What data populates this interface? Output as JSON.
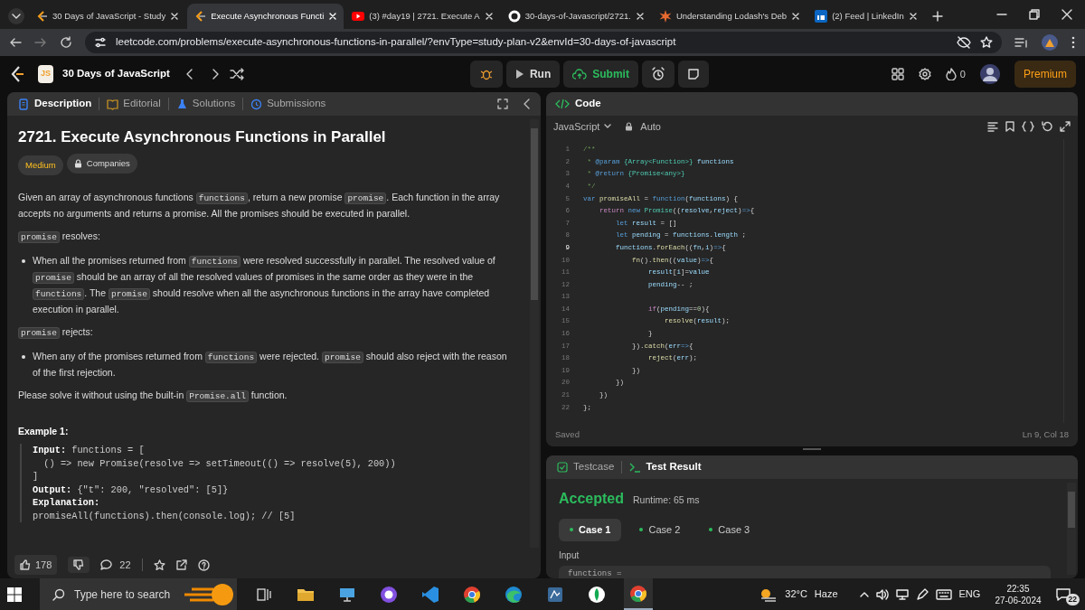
{
  "browser": {
    "tabs": [
      {
        "title": "30 Days of JavaScript - Study",
        "selected": false
      },
      {
        "title": "Execute Asynchronous Functi",
        "selected": true
      },
      {
        "title": "(3) #day19 | 2721. Execute A",
        "selected": false
      },
      {
        "title": "30-days-of-Javascript/2721.",
        "selected": false
      },
      {
        "title": "Understanding Lodash's Deb",
        "selected": false
      },
      {
        "title": "(2) Feed | LinkedIn",
        "selected": false
      }
    ],
    "url": "leetcode.com/problems/execute-asynchronous-functions-in-parallel/?envType=study-plan-v2&envId=30-days-of-javascript"
  },
  "topbar": {
    "badge": "JS",
    "study_plan": "30 Days of JavaScript",
    "run": "Run",
    "submit": "Submit",
    "streak": "0",
    "premium": "Premium"
  },
  "description_panel": {
    "tabs": [
      {
        "label": "Description",
        "selected": true
      },
      {
        "label": "Editorial",
        "selected": false
      },
      {
        "label": "Solutions",
        "selected": false
      },
      {
        "label": "Submissions",
        "selected": false
      }
    ],
    "title": "2721. Execute Asynchronous Functions in Parallel",
    "difficulty": "Medium",
    "companies": "Companies",
    "body": [
      {
        "kind": "para",
        "segments": [
          {
            "kind": "text",
            "text": "Given an array of asynchronous functions "
          },
          {
            "kind": "code",
            "text": "functions"
          },
          {
            "kind": "text",
            "text": ", return a new promise "
          },
          {
            "kind": "code",
            "text": "promise"
          },
          {
            "kind": "text",
            "text": ". Each function in the array accepts no arguments and returns a promise. All the promises should be executed in parallel."
          }
        ]
      },
      {
        "kind": "para",
        "segments": [
          {
            "kind": "code",
            "text": "promise"
          },
          {
            "kind": "text",
            "text": " resolves:"
          }
        ]
      },
      {
        "kind": "bullet",
        "segments": [
          {
            "kind": "text",
            "text": "When all the promises returned from "
          },
          {
            "kind": "code",
            "text": "functions"
          },
          {
            "kind": "text",
            "text": " were resolved successfully in parallel. The resolved value of "
          },
          {
            "kind": "code",
            "text": "promise"
          },
          {
            "kind": "text",
            "text": " should be an array of all the resolved values of promises in the same order as they were in the "
          },
          {
            "kind": "code",
            "text": "functions"
          },
          {
            "kind": "text",
            "text": ". The "
          },
          {
            "kind": "code",
            "text": "promise"
          },
          {
            "kind": "text",
            "text": " should resolve when all the asynchronous functions in the array have completed execution in parallel."
          }
        ]
      },
      {
        "kind": "para",
        "segments": [
          {
            "kind": "code",
            "text": "promise"
          },
          {
            "kind": "text",
            "text": " rejects:"
          }
        ]
      },
      {
        "kind": "bullet",
        "segments": [
          {
            "kind": "text",
            "text": "When any of the promises returned from "
          },
          {
            "kind": "code",
            "text": "functions"
          },
          {
            "kind": "text",
            "text": " were rejected. "
          },
          {
            "kind": "code",
            "text": "promise"
          },
          {
            "kind": "text",
            "text": " should also reject with the reason of the first rejection."
          }
        ]
      },
      {
        "kind": "para",
        "segments": [
          {
            "kind": "text",
            "text": "Please solve it without using the built-in "
          },
          {
            "kind": "code",
            "text": "Promise.all"
          },
          {
            "kind": "text",
            "text": " function."
          }
        ]
      }
    ],
    "example": {
      "heading": "Example 1:",
      "lines": [
        "**Input:** functions = [",
        "  () => new Promise(resolve => setTimeout(() => resolve(5), 200))",
        "]",
        "**Output:** {\"t\": 200, \"resolved\": [5]}",
        "**Explanation:**",
        "promiseAll(functions).then(console.log); // [5]"
      ]
    },
    "footer": {
      "likes": "178",
      "comments": "22"
    }
  },
  "code_panel": {
    "title": "Code",
    "language": "JavaScript",
    "mode": "Auto",
    "lines": [
      {
        "number": "1",
        "current": false,
        "tokens": [
          {
            "kind": "comment",
            "text": "/**"
          }
        ]
      },
      {
        "number": "2",
        "current": false,
        "tokens": [
          {
            "kind": "comment",
            "text": " * "
          },
          {
            "kind": "doctag",
            "text": "@param"
          },
          {
            "kind": "type",
            "text": " {Array<Function>}"
          },
          {
            "kind": "name",
            "text": " functions"
          }
        ]
      },
      {
        "number": "3",
        "current": false,
        "tokens": [
          {
            "kind": "comment",
            "text": " * "
          },
          {
            "kind": "doctag",
            "text": "@return"
          },
          {
            "kind": "type",
            "text": " {Promise<any>}"
          }
        ]
      },
      {
        "number": "4",
        "current": false,
        "tokens": [
          {
            "kind": "comment",
            "text": " */"
          }
        ]
      },
      {
        "number": "5",
        "current": false,
        "tokens": [
          {
            "kind": "keyword",
            "text": "var"
          },
          {
            "kind": "function",
            "text": " promiseAll"
          },
          {
            "kind": "punct",
            "text": " = "
          },
          {
            "kind": "keyword",
            "text": "function"
          },
          {
            "kind": "punct",
            "text": "("
          },
          {
            "kind": "name",
            "text": "functions"
          },
          {
            "kind": "punct",
            "text": ") {"
          }
        ]
      },
      {
        "number": "6",
        "current": false,
        "tokens": [
          {
            "kind": "control",
            "text": "    return"
          },
          {
            "kind": "keyword",
            "text": " new"
          },
          {
            "kind": "class",
            "text": " Promise"
          },
          {
            "kind": "punct",
            "text": "(("
          },
          {
            "kind": "name",
            "text": "resolve"
          },
          {
            "kind": "punct",
            "text": ","
          },
          {
            "kind": "name",
            "text": "reject"
          },
          {
            "kind": "punct",
            "text": ")"
          },
          {
            "kind": "keyword",
            "text": "=>"
          },
          {
            "kind": "punct",
            "text": "{"
          }
        ]
      },
      {
        "number": "7",
        "current": false,
        "tokens": [
          {
            "kind": "keyword",
            "text": "        let"
          },
          {
            "kind": "name",
            "text": " result"
          },
          {
            "kind": "punct",
            "text": " = []"
          }
        ]
      },
      {
        "number": "8",
        "current": false,
        "tokens": [
          {
            "kind": "keyword",
            "text": "        let"
          },
          {
            "kind": "name",
            "text": " pending"
          },
          {
            "kind": "punct",
            "text": " = "
          },
          {
            "kind": "name",
            "text": "functions"
          },
          {
            "kind": "punct",
            "text": "."
          },
          {
            "kind": "name",
            "text": "length"
          },
          {
            "kind": "punct",
            "text": " ;"
          }
        ]
      },
      {
        "number": "9",
        "current": true,
        "tokens": [
          {
            "kind": "name",
            "text": "        functions"
          },
          {
            "kind": "punct",
            "text": "."
          },
          {
            "kind": "function",
            "text": "forEach"
          },
          {
            "kind": "punct",
            "text": "(("
          },
          {
            "kind": "name",
            "text": "fn"
          },
          {
            "kind": "punct",
            "text": ","
          },
          {
            "kind": "name",
            "text": "i"
          },
          {
            "kind": "punct",
            "text": ")"
          },
          {
            "kind": "keyword",
            "text": "=>"
          },
          {
            "kind": "punct",
            "text": "{"
          }
        ]
      },
      {
        "number": "10",
        "current": false,
        "tokens": [
          {
            "kind": "function",
            "text": "            fn"
          },
          {
            "kind": "punct",
            "text": "()."
          },
          {
            "kind": "function",
            "text": "then"
          },
          {
            "kind": "punct",
            "text": "(("
          },
          {
            "kind": "name",
            "text": "value"
          },
          {
            "kind": "punct",
            "text": ")"
          },
          {
            "kind": "keyword",
            "text": "=>"
          },
          {
            "kind": "punct",
            "text": "{"
          }
        ]
      },
      {
        "number": "11",
        "current": false,
        "tokens": [
          {
            "kind": "name",
            "text": "                result"
          },
          {
            "kind": "punct",
            "text": "["
          },
          {
            "kind": "name",
            "text": "i"
          },
          {
            "kind": "punct",
            "text": "]="
          },
          {
            "kind": "name",
            "text": "value"
          }
        ]
      },
      {
        "number": "12",
        "current": false,
        "tokens": [
          {
            "kind": "name",
            "text": "                pending"
          },
          {
            "kind": "punct",
            "text": "-- ;"
          }
        ]
      },
      {
        "number": "13",
        "current": false
      },
      {
        "number": "14",
        "current": false,
        "tokens": [
          {
            "kind": "control",
            "text": "                if"
          },
          {
            "kind": "punct",
            "text": "("
          },
          {
            "kind": "name",
            "text": "pending"
          },
          {
            "kind": "punct",
            "text": "=="
          },
          {
            "kind": "number",
            "text": "0"
          },
          {
            "kind": "punct",
            "text": "){"
          }
        ]
      },
      {
        "number": "15",
        "current": false,
        "tokens": [
          {
            "kind": "function",
            "text": "                    resolve"
          },
          {
            "kind": "punct",
            "text": "("
          },
          {
            "kind": "name",
            "text": "result"
          },
          {
            "kind": "punct",
            "text": ");"
          }
        ]
      },
      {
        "number": "16",
        "current": false,
        "tokens": [
          {
            "kind": "punct",
            "text": "                }"
          }
        ]
      },
      {
        "number": "17",
        "current": false,
        "tokens": [
          {
            "kind": "punct",
            "text": "            })."
          },
          {
            "kind": "function",
            "text": "catch"
          },
          {
            "kind": "punct",
            "text": "("
          },
          {
            "kind": "name",
            "text": "err"
          },
          {
            "kind": "keyword",
            "text": "=>"
          },
          {
            "kind": "punct",
            "text": "{"
          }
        ]
      },
      {
        "number": "18",
        "current": false,
        "tokens": [
          {
            "kind": "function",
            "text": "                reject"
          },
          {
            "kind": "punct",
            "text": "("
          },
          {
            "kind": "name",
            "text": "err"
          },
          {
            "kind": "punct",
            "text": ");"
          }
        ]
      },
      {
        "number": "19",
        "current": false,
        "tokens": [
          {
            "kind": "punct",
            "text": "            })"
          }
        ]
      },
      {
        "number": "20",
        "current": false,
        "tokens": [
          {
            "kind": "punct",
            "text": "        })"
          }
        ]
      },
      {
        "number": "21",
        "current": false,
        "tokens": [
          {
            "kind": "punct",
            "text": "    })"
          }
        ]
      },
      {
        "number": "22",
        "current": false,
        "tokens": [
          {
            "kind": "punct",
            "text": "};"
          }
        ]
      }
    ],
    "status": "Saved",
    "cursor": "Ln 9, Col 18"
  },
  "test_panel": {
    "tabs": [
      {
        "label": "Testcase",
        "selected": false
      },
      {
        "label": "Test Result",
        "selected": true
      }
    ],
    "verdict": "Accepted",
    "runtime": "Runtime: 65 ms",
    "cases": [
      {
        "label": "Case 1",
        "passed": true,
        "selected": true
      },
      {
        "label": "Case 2",
        "passed": true,
        "selected": false
      },
      {
        "label": "Case 3",
        "passed": true,
        "selected": false
      }
    ],
    "input_label": "Input",
    "input_value": "functions ="
  },
  "taskbar": {
    "search_placeholder": "Type here to search",
    "temperature": "32°C",
    "condition": "Haze",
    "language": "ENG",
    "time": "22:35",
    "date": "27-06-2024",
    "notifications": "22"
  }
}
